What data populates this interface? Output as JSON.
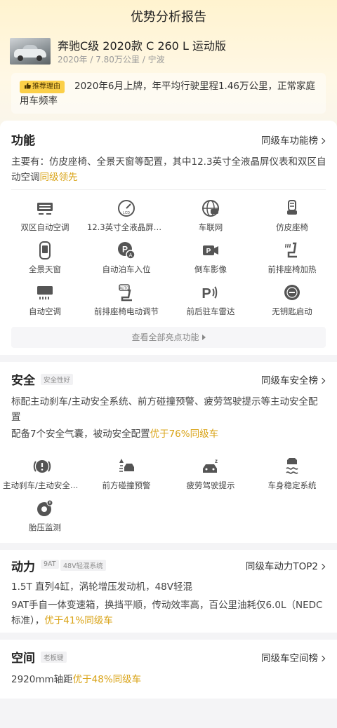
{
  "header": {
    "title": "优势分析报告"
  },
  "car": {
    "name": "奔驰C级 2020款 C 260 L 运动版",
    "meta": "2020年 / 7.80万公里 / 宁波"
  },
  "reason": {
    "tag": "推荐理由",
    "text": "2020年6月上牌，年平均行驶里程1.46万公里，正常家庭用车频率"
  },
  "function_section": {
    "title": "功能",
    "link": "同级车功能榜",
    "desc_prefix": "主要有：仿皮座椅、全景天窗等配置，其中12.3英寸全液晶屏仪表和双区自动空调",
    "desc_highlight": "同级领先",
    "features": [
      {
        "label": "双区自动空调",
        "icon": "dual-zone-climate-icon"
      },
      {
        "label": "12.3英寸全液晶屏仪表",
        "icon": "lcd-gauge-icon"
      },
      {
        "label": "车联网",
        "icon": "connected-car-icon"
      },
      {
        "label": "仿皮座椅",
        "icon": "leather-seat-icon"
      },
      {
        "label": "全景天窗",
        "icon": "panoramic-sunroof-icon"
      },
      {
        "label": "自动泊车入位",
        "icon": "auto-parking-icon"
      },
      {
        "label": "倒车影像",
        "icon": "rear-camera-icon"
      },
      {
        "label": "前排座椅加热",
        "icon": "seat-heating-icon"
      },
      {
        "label": "自动空调",
        "icon": "auto-climate-icon"
      },
      {
        "label": "前排座椅电动调节",
        "icon": "power-seat-icon"
      },
      {
        "label": "前后驻车雷达",
        "icon": "parking-radar-icon"
      },
      {
        "label": "无钥匙启动",
        "icon": "keyless-start-icon"
      }
    ],
    "view_all": "查看全部亮点功能"
  },
  "safety_section": {
    "title": "安全",
    "badge": "安全性好",
    "link": "同级车安全榜",
    "desc1": "标配主动刹车/主动安全系统、前方碰撞预警、疲劳驾驶提示等主动安全配置",
    "desc2_prefix": "配备7个安全气囊，被动安全配置",
    "desc2_highlight": "优于76%同级车",
    "features": [
      {
        "label": "主动刹车/主动安全系统",
        "icon": "active-brake-icon"
      },
      {
        "label": "前方碰撞预警",
        "icon": "collision-warning-icon"
      },
      {
        "label": "疲劳驾驶提示",
        "icon": "fatigue-alert-icon"
      },
      {
        "label": "车身稳定系统",
        "icon": "stability-control-icon"
      },
      {
        "label": "胎压监测",
        "icon": "tire-pressure-icon"
      }
    ]
  },
  "power_section": {
    "title": "动力",
    "badges": [
      "9AT",
      "48V轻混系统"
    ],
    "link": "同级车动力TOP2",
    "desc1": "1.5T 直列4缸，涡轮增压发动机，48V轻混",
    "desc2_prefix": "9AT手自一体变速箱，换挡平顺，传动效率高，百公里油耗仅6.0L（NEDC标准），",
    "desc2_highlight": "优于41%同级车"
  },
  "space_section": {
    "title": "空间",
    "badge": "老板键",
    "link": "同级车空间榜",
    "desc_prefix": "2920mm轴距",
    "desc_highlight": "优于48%同级车"
  },
  "colors": {
    "accent": "#d9a316",
    "tag": "#fbcf48",
    "icon": "#4a4a4a"
  }
}
